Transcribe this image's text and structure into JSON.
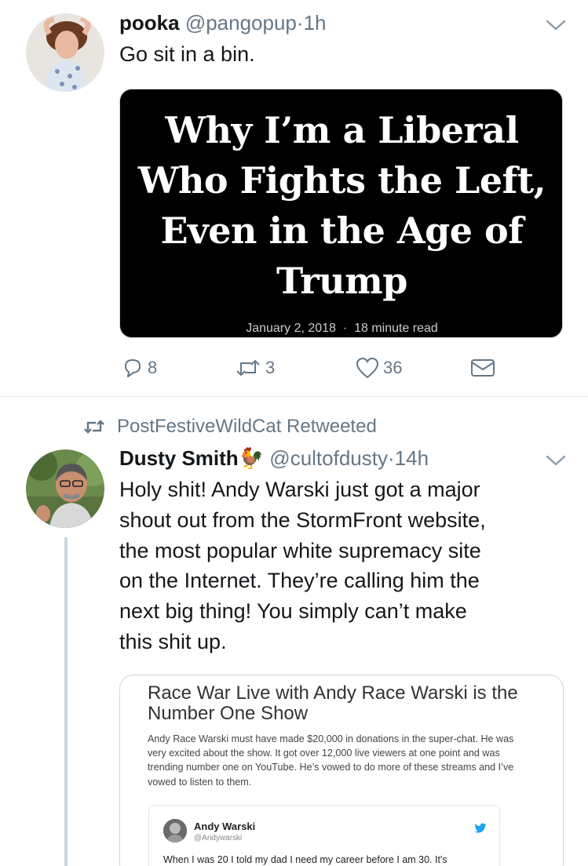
{
  "tweet1": {
    "display_name": "pooka",
    "handle": "@pangopup",
    "separator": "·",
    "time": "1h",
    "text": "Go sit in a bin.",
    "card": {
      "headline_lines": [
        "Why I’m a Liberal",
        "Who Fights the Left,",
        "Even in the Age of",
        "Trump"
      ],
      "date": "January 2, 2018",
      "meta_separator": "·",
      "read_time": "18 minute read"
    },
    "actions": {
      "reply_count": "8",
      "retweet_count": "3",
      "like_count": "36"
    }
  },
  "tweet2": {
    "retweet_label": "PostFestiveWildCat Retweeted",
    "display_name": "Dusty Smith",
    "name_emoji": "🐓",
    "handle": "@cultofdusty",
    "separator": "·",
    "time": "14h",
    "text_lines": [
      "Holy shit! Andy Warski just got a major",
      "shout out from the StormFront website,",
      "the most popular white supremacy site",
      "on the Internet. They’re calling him the",
      "next big thing! You simply can’t make",
      "this shit up."
    ],
    "embed": {
      "title_lines": [
        "Race War Live with Andy Race Warski is the",
        "Number One Show"
      ],
      "body_lines": [
        "Andy Race Warski must have made $20,000 in donations in the super-chat. He was",
        "very excited about the show. It got over 12,000 live viewers at one point and was",
        "trending number one on YouTube. He’s vowed to do more of these streams and I’ve",
        "vowed to listen to them."
      ],
      "inner_tweet": {
        "name": "Andy Warski",
        "handle": "@Andywarski",
        "text": "When I was 20 I told my dad I need my career before I am 30. It's"
      }
    }
  },
  "colors": {
    "text": "#14171a",
    "muted": "#657786",
    "border": "#e1e8ed",
    "twitter_blue": "#1da1f2"
  },
  "icons": [
    "chevron-down-icon",
    "reply-icon",
    "retweet-icon",
    "like-icon",
    "dm-icon",
    "retweeted-icon",
    "twitter-bird-icon"
  ]
}
